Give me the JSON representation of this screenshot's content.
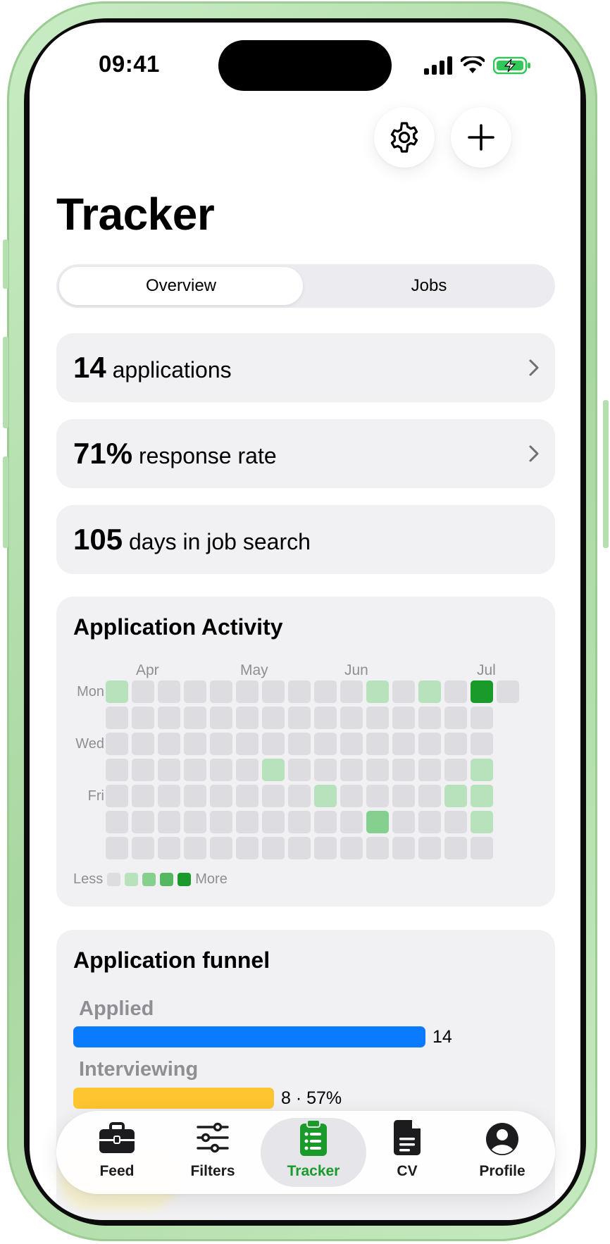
{
  "status_bar": {
    "time": "09:41"
  },
  "page": {
    "title": "Tracker"
  },
  "segmented": {
    "overview": "Overview",
    "jobs": "Jobs"
  },
  "stats": [
    {
      "value": "14",
      "label": "applications",
      "has_chevron": true
    },
    {
      "value": "71%",
      "label": "response rate",
      "has_chevron": true
    },
    {
      "value": "105",
      "label": "days in job search",
      "has_chevron": false
    }
  ],
  "activity": {
    "title": "Application Activity",
    "months": [
      "Apr",
      "May",
      "Jun",
      "Jul"
    ],
    "days": [
      "Mon",
      "Wed",
      "Fri"
    ],
    "legend_less": "Less",
    "legend_more": "More",
    "colors": [
      "#dcdce1",
      "#b7e2bb",
      "#86d08f",
      "#53b85f",
      "#1a9a2a"
    ],
    "grid_levels": [
      [
        1,
        0,
        0,
        0,
        0,
        0,
        0,
        0,
        0,
        0,
        1,
        0,
        1,
        0,
        4,
        0
      ],
      [
        0,
        0,
        0,
        0,
        0,
        0,
        0,
        0,
        0,
        0,
        0,
        0,
        0,
        0,
        0
      ],
      [
        0,
        0,
        0,
        0,
        0,
        0,
        0,
        0,
        0,
        0,
        0,
        0,
        0,
        0,
        0
      ],
      [
        0,
        0,
        0,
        0,
        0,
        0,
        1,
        0,
        0,
        0,
        0,
        0,
        0,
        0,
        1
      ],
      [
        0,
        0,
        0,
        0,
        0,
        0,
        0,
        0,
        1,
        0,
        0,
        0,
        0,
        1,
        1
      ],
      [
        0,
        0,
        0,
        0,
        0,
        0,
        0,
        0,
        0,
        0,
        2,
        0,
        0,
        0,
        1
      ],
      [
        0,
        0,
        0,
        0,
        0,
        0,
        0,
        0,
        0,
        0,
        0,
        0,
        0,
        0,
        0
      ]
    ]
  },
  "funnel": {
    "title": "Application funnel",
    "stages": [
      {
        "label": "Applied",
        "value": "14",
        "fraction": 1.0,
        "color": "#0a7aff"
      },
      {
        "label": "Interviewing",
        "value": "8 · 57%",
        "fraction": 0.57,
        "color": "#fdc52f"
      }
    ]
  },
  "tabs": [
    {
      "label": "Feed",
      "icon": "briefcase-icon",
      "active": false
    },
    {
      "label": "Filters",
      "icon": "sliders-icon",
      "active": false
    },
    {
      "label": "Tracker",
      "icon": "clipboard-list-icon",
      "active": true
    },
    {
      "label": "CV",
      "icon": "document-icon",
      "active": false
    },
    {
      "label": "Profile",
      "icon": "person-circle-icon",
      "active": false
    }
  ],
  "accent_color": "#1a9a2a"
}
